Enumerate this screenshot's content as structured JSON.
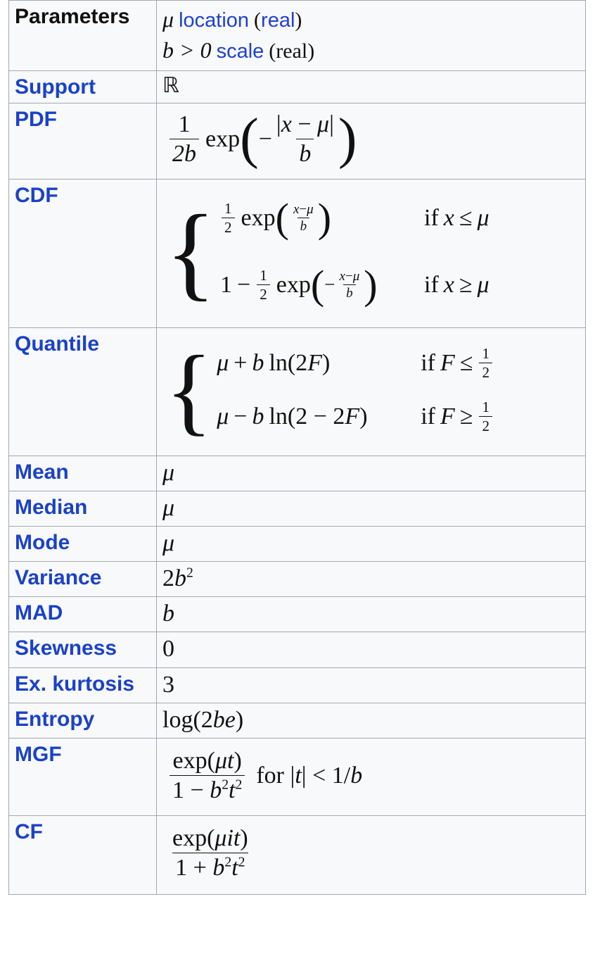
{
  "infobox": {
    "title": "Laplace distribution parameters infobox",
    "colors": {
      "link_blue": "#1a41c8",
      "cell_background": "#f8f9fa",
      "border": "#a2a9b1",
      "text": "#101010"
    },
    "rows": [
      {
        "label": "Parameters",
        "label_is_link": false,
        "value_kind": "parameters",
        "lines": [
          {
            "symbol": "μ",
            "name": "location",
            "qualifier": "(real)",
            "qualifier_blue": true
          },
          {
            "symbol": "b > 0",
            "name": "scale",
            "qualifier": "(real)",
            "qualifier_blue": false
          }
        ]
      },
      {
        "label": "Support",
        "label_is_link": true,
        "value_kind": "plain",
        "value": "ℝ"
      },
      {
        "label": "PDF",
        "label_is_link": true,
        "value_kind": "pdf",
        "formula": "(1/(2b)) exp(-|x-μ|/b)"
      },
      {
        "label": "CDF",
        "label_is_link": true,
        "value_kind": "cdf",
        "case1_expr": "½ exp((x-μ)/b)",
        "case1_cond": "if x ≤ μ",
        "case2_expr": "1 - ½ exp(-(x-μ)/b)",
        "case2_cond": "if x ≥ μ"
      },
      {
        "label": "Quantile",
        "label_is_link": true,
        "value_kind": "quantile",
        "case1_expr": "μ + b ln(2F)",
        "case1_cond": "if F ≤ ½",
        "case2_expr": "μ - b ln(2 - 2F)",
        "case2_cond": "if F ≥ ½"
      },
      {
        "label": "Mean",
        "label_is_link": true,
        "value_kind": "italic",
        "value": "μ"
      },
      {
        "label": "Median",
        "label_is_link": true,
        "value_kind": "italic",
        "value": "μ"
      },
      {
        "label": "Mode",
        "label_is_link": true,
        "value_kind": "italic",
        "value": "μ"
      },
      {
        "label": "Variance",
        "label_is_link": true,
        "value_kind": "pow",
        "base": "2b",
        "exp": "2"
      },
      {
        "label": "MAD",
        "label_is_link": true,
        "value_kind": "italic",
        "value": "b"
      },
      {
        "label": "Skewness",
        "label_is_link": true,
        "value_kind": "plain",
        "value": "0"
      },
      {
        "label": "Ex. kurtosis",
        "label_is_link": true,
        "value_kind": "plain",
        "value": "3"
      },
      {
        "label": "Entropy",
        "label_is_link": true,
        "value_kind": "entropy",
        "value": "log(2be)"
      },
      {
        "label": "MGF",
        "label_is_link": true,
        "value_kind": "mgf",
        "numerator": "exp(μt)",
        "denominator": "1 − b²t²",
        "condition": "for |t| < 1/b"
      },
      {
        "label": "CF",
        "label_is_link": true,
        "value_kind": "cf",
        "numerator": "exp(μit)",
        "denominator": "1 + b²t²"
      }
    ]
  },
  "text": {
    "parameters": "Parameters",
    "mu": "μ",
    "location": "location",
    "real_paren_open": "(",
    "real": "real",
    "real_paren_close": ")",
    "b_gt_0": "b > 0",
    "scale": "scale",
    "real_plain": "(real)",
    "support_label": "Support",
    "support_value": "ℝ",
    "pdf_label": "PDF",
    "cdf_label": "CDF",
    "quantile_label": "Quantile",
    "mean_label": "Mean",
    "median_label": "Median",
    "mode_label": "Mode",
    "variance_label": "Variance",
    "mad_label": "MAD",
    "skewness_label": "Skewness",
    "skewness_value": "0",
    "kurtosis_label": "Ex. kurtosis",
    "kurtosis_value": "3",
    "entropy_label": "Entropy",
    "mgf_label": "MGF",
    "cf_label": "CF",
    "one": "1",
    "two": "2",
    "two_b": "2b",
    "b": "b",
    "x": "x",
    "F": "F",
    "t": "t",
    "exp": "exp",
    "ln": "ln",
    "log": "log",
    "for": "for",
    "if": "if",
    "leq": "≤",
    "geq": "≥",
    "lt": "<",
    "minus": "−",
    "plus": "+",
    "abs": "|",
    "one_over_b": "1/b",
    "two_b_e": "2be",
    "twoF": "2F",
    "two_minus_2F": "2 − 2F"
  }
}
